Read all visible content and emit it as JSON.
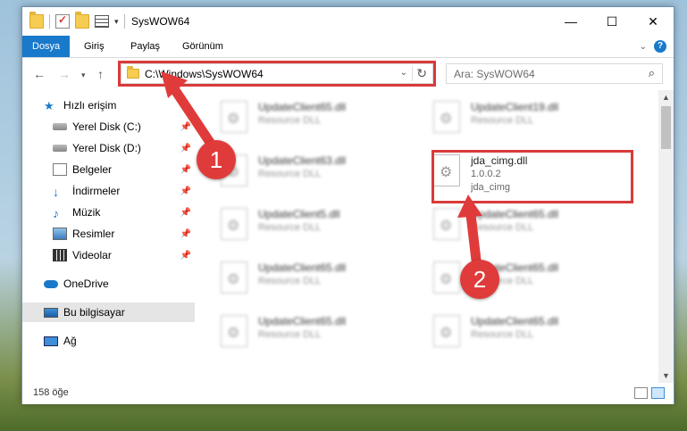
{
  "window": {
    "title": "SysWOW64",
    "buttons": {
      "minimize": "—",
      "maximize": "☐",
      "close": "✕"
    }
  },
  "ribbon": {
    "tabs": [
      "Dosya",
      "Giriş",
      "Paylaş",
      "Görünüm"
    ],
    "active_tab": "Dosya",
    "help_label": "?"
  },
  "nav": {
    "address": "C:\\Windows\\SysWOW64",
    "search_placeholder": "Ara: SysWOW64"
  },
  "sidebar": {
    "items": [
      {
        "label": "Hızlı erişim",
        "icon": "star-icon"
      },
      {
        "label": "Yerel Disk (C:)",
        "icon": "drive-icon",
        "pinned": true
      },
      {
        "label": "Yerel Disk (D:)",
        "icon": "drive-icon",
        "pinned": true
      },
      {
        "label": "Belgeler",
        "icon": "documents-icon",
        "pinned": true
      },
      {
        "label": "İndirmeler",
        "icon": "downloads-icon",
        "pinned": true
      },
      {
        "label": "Müzik",
        "icon": "music-icon",
        "pinned": true
      },
      {
        "label": "Resimler",
        "icon": "pictures-icon",
        "pinned": true
      },
      {
        "label": "Videolar",
        "icon": "videos-icon",
        "pinned": true
      },
      {
        "label": "OneDrive",
        "icon": "onedrive-icon"
      },
      {
        "label": "Bu bilgisayar",
        "icon": "this-pc-icon",
        "selected": true
      },
      {
        "label": "Ağ",
        "icon": "network-icon"
      }
    ]
  },
  "files": [
    {
      "name": "UpdateClient65.dll",
      "type": "Resource DLL"
    },
    {
      "name": "UpdateClient19.dll",
      "type": "Resource DLL"
    },
    {
      "name": "UpdateClient63.dll",
      "type": "Resource DLL"
    },
    {
      "name": "jda_cimg.dll",
      "version": "1.0.0.2",
      "type": "jda_cimg"
    },
    {
      "name": "UpdateClient5.dll",
      "type": "Resource DLL"
    },
    {
      "name": "UpdateClient65.dll",
      "type": "Resource DLL"
    },
    {
      "name": "UpdateClient65.dll",
      "type": "Resource DLL"
    },
    {
      "name": "UpdateClient65.dll",
      "type": "Resource DLL"
    },
    {
      "name": "UpdateClient65.dll",
      "type": "Resource DLL"
    },
    {
      "name": "UpdateClient65.dll",
      "type": "Resource DLL"
    }
  ],
  "status": {
    "count": "158 öğe"
  },
  "annotations": {
    "step1": "1",
    "step2": "2"
  },
  "colors": {
    "accent": "#1979ca",
    "highlight": "#d93a3a"
  }
}
